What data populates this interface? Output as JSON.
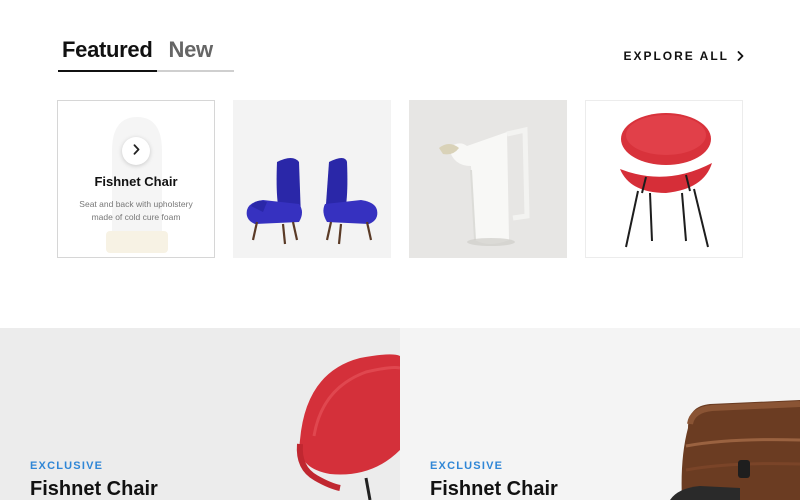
{
  "tabs": [
    {
      "label": "Featured",
      "active": true
    },
    {
      "label": "New",
      "active": false
    }
  ],
  "explore": {
    "label": "EXPLORE ALL",
    "icon": "chevron-right-icon"
  },
  "featured_card": {
    "title": "Fishnet Chair",
    "description": "Seat and back with upholstery made of cold cure foam",
    "icon": "chevron-right-icon"
  },
  "products": [
    {
      "image": "blue-chairs-pair"
    },
    {
      "image": "white-ceramic-pitcher"
    },
    {
      "image": "red-shell-chair"
    }
  ],
  "banners": [
    {
      "eyebrow": "EXCLUSIVE",
      "title": "Fishnet Chair",
      "image": "red-chair"
    },
    {
      "eyebrow": "EXCLUSIVE",
      "title": "Fishnet Chair",
      "image": "walnut-lounge-chair"
    }
  ],
  "colors": {
    "accent": "#2f86d6",
    "chair_red": "#d8323b",
    "chair_blue": "#2f2bb0"
  }
}
